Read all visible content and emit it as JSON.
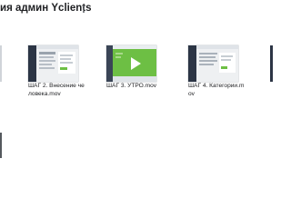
{
  "folder": {
    "title": "ия админ Yclients"
  },
  "files": [
    {
      "name": "ШАГ 2. Внесение человека.mov",
      "thumbnail": "screen-recording-form"
    },
    {
      "name": "ШАГ 3. УТРО.mov",
      "thumbnail": "video-play-green"
    },
    {
      "name": "ШАГ 4. Категории.mov",
      "thumbnail": "screen-recording-list"
    }
  ],
  "colors": {
    "accent_green": "#6dbf44",
    "sidebar_dark": "#2c3545",
    "text": "#202124"
  }
}
